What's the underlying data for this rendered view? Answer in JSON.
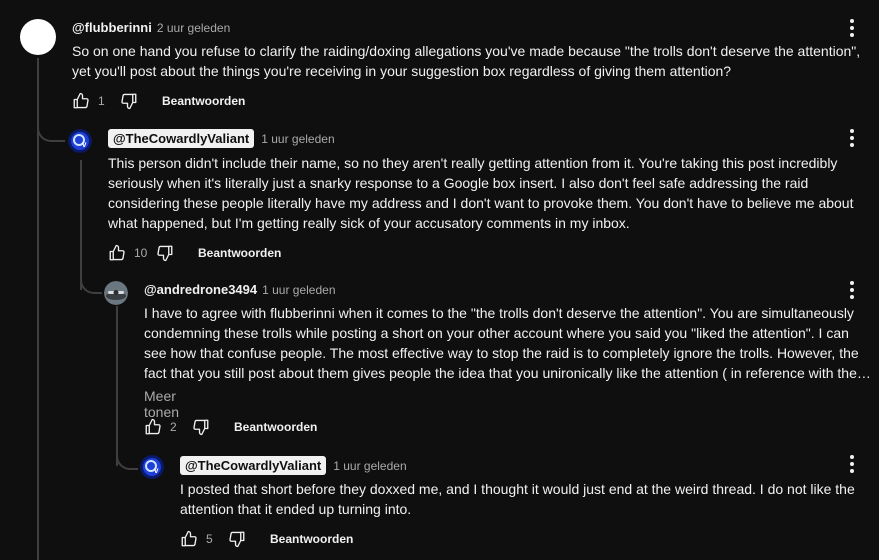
{
  "comments": [
    {
      "author": "@flubberinni",
      "time": "2 uur geleden",
      "lines": [
        "So on one hand you refuse to clarify the raiding/doxing allegations you've made because \"the trolls don't deserve the attention\",",
        "yet you'll post about the things you're receiving in your suggestion box regardless of giving them attention?"
      ],
      "likes": "1",
      "reply_label": "Beantwoorden"
    },
    {
      "author": "@TheCowardlyValiant",
      "time": "1 uur geleden",
      "lines": [
        "This person didn't include their name, so no they aren't really getting attention from it. You're taking this post incredibly",
        "seriously when it's literally just a snarky response to a Google box insert. I also don't feel safe addressing the raid",
        "considering these people literally have my address and I don't want to provoke them. You don't have to believe me about",
        "what happened, but I'm getting really sick of your accusatory comments in my inbox."
      ],
      "likes": "10",
      "reply_label": "Beantwoorden"
    },
    {
      "author": "@andredrone3494",
      "time": "1 uur geleden",
      "lines": [
        "I have to agree with flubberinni when it comes to the \"the trolls don't deserve the attention\". You are simultaneously",
        "condemning these trolls while posting a short on your other account where you said you \"liked the attention\". I can",
        "see how that confuse people. The most effective way to stop the raid is to completely ignore the trolls. However, the",
        "fact that you still post about them gives people the idea that you unironically like the attention ( in reference with the …"
      ],
      "show_more": "Meer tonen",
      "likes": "2",
      "reply_label": "Beantwoorden"
    },
    {
      "author": "@TheCowardlyValiant",
      "time": "1 uur geleden",
      "lines": [
        "I posted that short before they doxxed me, and I thought it would just end at the weird thread. I do not like the",
        "attention that it ended up turning into."
      ],
      "likes": "5",
      "reply_label": "Beantwoorden"
    }
  ],
  "icons": {
    "like": "thumbs-up-icon",
    "dislike": "thumbs-down-icon",
    "more": "more-vertical-icon"
  },
  "colors": {
    "background": "#0f0f0f",
    "text": "#f1f1f1",
    "muted": "#aaaaaa",
    "creator_pill": "#f1f1f1",
    "thread_line": "#3f3f3f"
  }
}
